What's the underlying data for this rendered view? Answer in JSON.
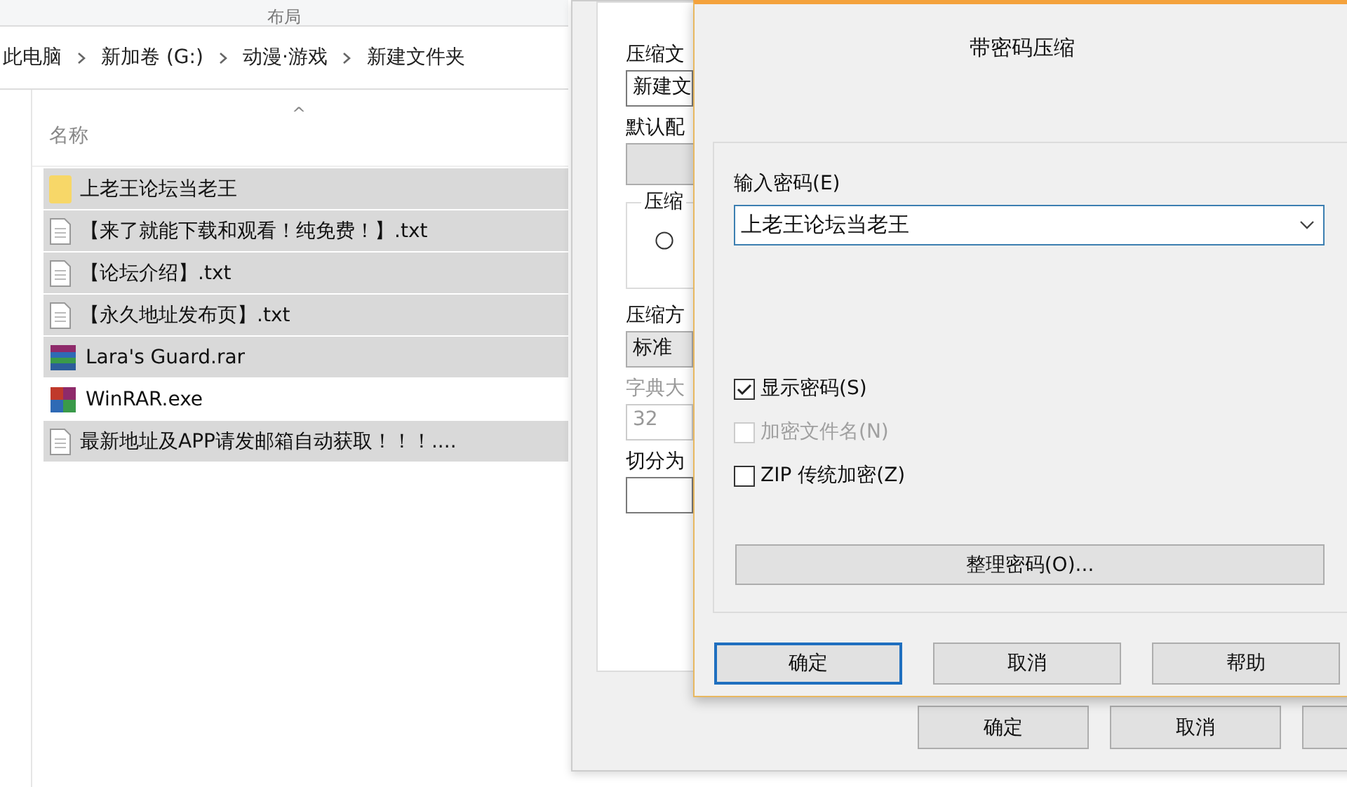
{
  "explorer": {
    "ribbon_group": "布局",
    "breadcrumb": [
      "此电脑",
      "新加卷 (G:)",
      "动漫·游戏",
      "新建文件夹"
    ],
    "column": {
      "label": "名称",
      "sort_indicator": "^"
    },
    "files": [
      {
        "name": "上老王论坛当老王",
        "kind": "folder",
        "selected": true
      },
      {
        "name": "【来了就能下载和观看！纯免费！】.txt",
        "kind": "text",
        "selected": true
      },
      {
        "name": "【论坛介绍】.txt",
        "kind": "text",
        "selected": true
      },
      {
        "name": "【永久地址发布页】.txt",
        "kind": "text",
        "selected": true
      },
      {
        "name": "Lara's Guard.rar",
        "kind": "archive",
        "selected": true
      },
      {
        "name": "WinRAR.exe",
        "kind": "program",
        "selected": false
      },
      {
        "name": "最新地址及APP请发邮箱自动获取！！！....",
        "kind": "text",
        "selected": true
      }
    ]
  },
  "archive_dialog": {
    "fields": [
      {
        "label": "压缩文",
        "kind": "input",
        "value": "新建文",
        "disabled": false
      },
      {
        "label": "默认配",
        "kind": "button",
        "disabled": false
      },
      {
        "label": "压缩",
        "kind": "group",
        "disabled": false,
        "radio_selected": false
      },
      {
        "label": "压缩方",
        "kind": "select",
        "value": "标准",
        "disabled": false
      },
      {
        "label": "字典大",
        "kind": "select",
        "value": "32",
        "disabled": true
      },
      {
        "label": "切分为",
        "kind": "input",
        "disabled": false
      }
    ],
    "buttons": [
      "确定",
      "取消"
    ]
  },
  "password_dialog": {
    "title": "带密码压缩",
    "password_label": "输入密码(E)",
    "password_value": "上老王论坛当老王",
    "options": [
      {
        "label": "显示密码(S)",
        "checked": true,
        "disabled": false
      },
      {
        "label": "加密文件名(N)",
        "checked": false,
        "disabled": true
      },
      {
        "label": "ZIP 传统加密(Z)",
        "checked": false,
        "disabled": false
      }
    ],
    "organize_button": "整理密码(O)...",
    "buttons": [
      {
        "label": "确定",
        "default": true
      },
      {
        "label": "取消",
        "default": false
      },
      {
        "label": "帮助",
        "default": false
      }
    ]
  }
}
